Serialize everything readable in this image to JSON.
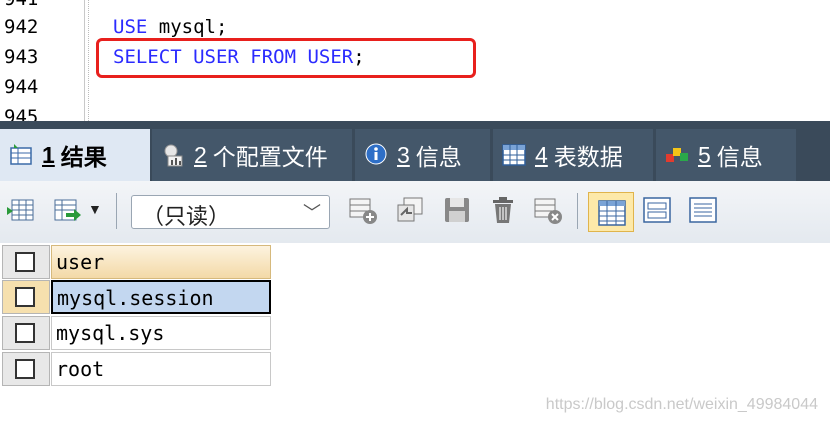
{
  "editor": {
    "line_numbers": [
      "941",
      "942",
      "943",
      "944",
      "945"
    ],
    "lines": [
      {
        "tokens": [
          {
            "kind": "kw",
            "text": "USE"
          },
          {
            "kind": "plain",
            "text": " mysql;"
          }
        ]
      },
      {
        "tokens": [
          {
            "kind": "kw",
            "text": "SELECT USER FROM USER"
          },
          {
            "kind": "plain",
            "text": ";"
          }
        ]
      }
    ]
  },
  "tabs": [
    {
      "num": "1",
      "label": "结果",
      "icon": "result-grid-icon",
      "active": true
    },
    {
      "num": "2",
      "label": "个配置文件",
      "icon": "profile-icon",
      "active": false
    },
    {
      "num": "3",
      "label": "信息",
      "icon": "info-icon",
      "active": false
    },
    {
      "num": "4",
      "label": "表数据",
      "icon": "table-data-icon",
      "active": false
    },
    {
      "num": "5",
      "label": "信息",
      "icon": "info-blocks-icon",
      "active": false
    }
  ],
  "toolbar": {
    "mode_select_value": "（只读）",
    "buttons": [
      "export-grid-icon",
      "import-grid-icon",
      "add-row-icon",
      "duplicate-row-icon",
      "save-icon",
      "delete-icon",
      "cancel-changes-icon",
      "grid-view-icon",
      "form-view-icon",
      "text-view-icon"
    ]
  },
  "grid": {
    "column_header": "user",
    "rows": [
      "mysql.session",
      "mysql.sys",
      "root"
    ],
    "selected_row": 0
  },
  "watermark": "https://blog.csdn.net/weixin_49984044",
  "colors": {
    "keyword": "#2b2bff",
    "highlight_box": "#e8201d",
    "tabbar": "#3a4a5a"
  }
}
